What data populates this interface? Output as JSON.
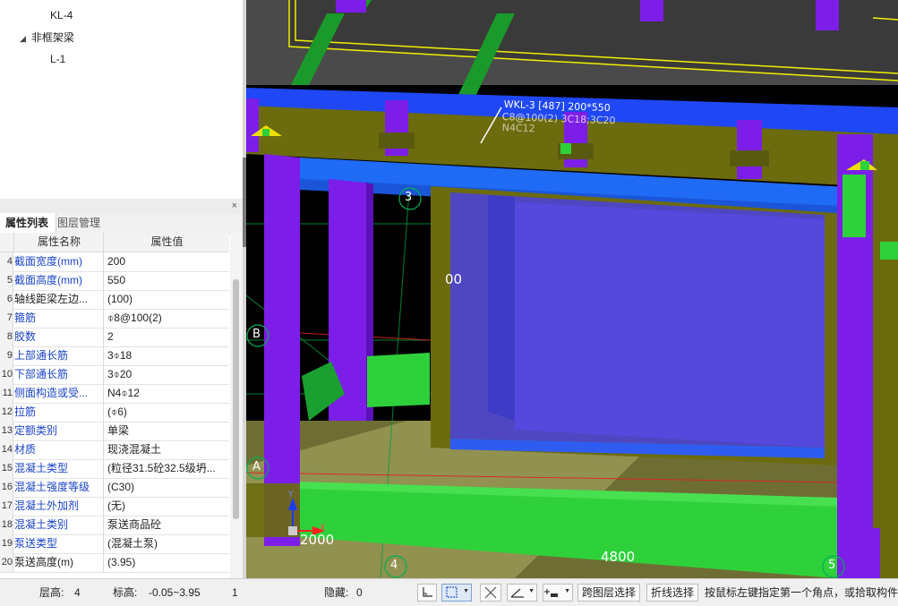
{
  "tree": {
    "items": [
      {
        "label": "KL-4",
        "indent": 2,
        "expanded": false
      },
      {
        "label": "非框架梁",
        "indent": 1,
        "expanded": true
      },
      {
        "label": "L-1",
        "indent": 2,
        "expanded": false
      }
    ]
  },
  "properties": {
    "close_label": "×",
    "tabs": [
      {
        "label": "属性列表",
        "active": true
      },
      {
        "label": "图层管理",
        "active": false
      }
    ],
    "columns": {
      "name": "属性名称",
      "value": "属性值"
    },
    "rows": [
      {
        "num": "4",
        "name": "截面宽度(mm)",
        "value": "200",
        "blue": true
      },
      {
        "num": "5",
        "name": "截面高度(mm)",
        "value": "550",
        "blue": true
      },
      {
        "num": "6",
        "name": "轴线距梁左边...",
        "value": "(100)",
        "blue": false
      },
      {
        "num": "7",
        "name": "箍筋",
        "value": "⌽8@100(2)",
        "blue": true
      },
      {
        "num": "8",
        "name": "胶数",
        "value": "2",
        "blue": true
      },
      {
        "num": "9",
        "name": "上部通长筋",
        "value": "3⌽18",
        "blue": true
      },
      {
        "num": "10",
        "name": "下部通长筋",
        "value": "3⌽20",
        "blue": true
      },
      {
        "num": "11",
        "name": "侧面构造或受...",
        "value": "N4⌽12",
        "blue": true
      },
      {
        "num": "12",
        "name": "拉筋",
        "value": "(⌽6)",
        "blue": true
      },
      {
        "num": "13",
        "name": "定额类别",
        "value": "单梁",
        "blue": true
      },
      {
        "num": "14",
        "name": "材质",
        "value": "现浇混凝土",
        "blue": true
      },
      {
        "num": "15",
        "name": "混凝土类型",
        "value": "(粒径31.5砼32.5级坍...",
        "blue": true
      },
      {
        "num": "16",
        "name": "混凝土强度等级",
        "value": "(C30)",
        "blue": true
      },
      {
        "num": "17",
        "name": "混凝土外加剂",
        "value": "(无)",
        "blue": true
      },
      {
        "num": "18",
        "name": "混凝土类别",
        "value": "泵送商品砼",
        "blue": true
      },
      {
        "num": "19",
        "name": "泵送类型",
        "value": "(混凝土泵)",
        "blue": true
      },
      {
        "num": "20",
        "name": "泵送高度(m)",
        "value": "(3.95)",
        "blue": false
      }
    ]
  },
  "viewport": {
    "beam_annotation_line1": "WKL-3 [487] 200*550",
    "beam_annotation_line2": "C8@100(2) 3C18;3C20",
    "beam_annotation_line3": "N4C12",
    "axis_labels": [
      "3",
      "B",
      "A",
      "4",
      "5"
    ],
    "dimension_texts": [
      "00",
      "2000",
      "4800"
    ],
    "ucs_x_label": "X",
    "ucs_y_label": "Y"
  },
  "status_bar": {
    "floor_label": "层高:",
    "floor_value": "4",
    "elevation_label": "标高:",
    "elevation_value": "-0.05~3.95",
    "count_value": "1",
    "hidden_label": "隐藏:",
    "hidden_value": "0",
    "cross_layer_button": "跨图层选择",
    "polyline_button": "折线选择",
    "hint_text": "按鼠标左键指定第一个角点，或拾取构件"
  },
  "colors": {
    "beam_olive": "#6c6b0e",
    "column_purple": "#7c1ee8",
    "slab_green": "#2fd13b",
    "beam_blue": "#1f47f5",
    "label_blue": "#1a44c8"
  }
}
